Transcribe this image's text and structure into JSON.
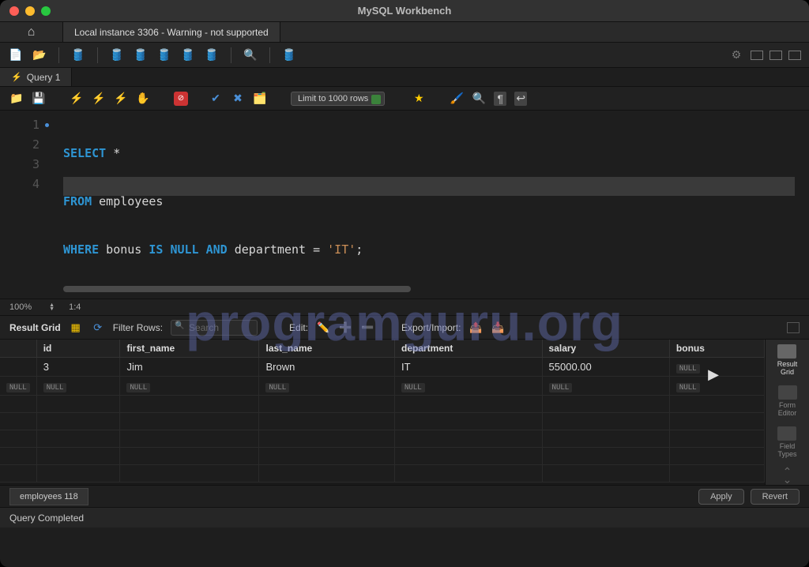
{
  "app": {
    "title": "MySQL Workbench"
  },
  "connection": {
    "tab": "Local instance 3306 - Warning - not supported"
  },
  "queryTab": {
    "label": "Query 1"
  },
  "editor": {
    "limit": "Limit to 1000 rows",
    "lines": [
      "1",
      "2",
      "3",
      "4"
    ],
    "code": {
      "l1_kw": "SELECT",
      "l1_rest": " *",
      "l2_kw": "FROM",
      "l2_rest": " employees",
      "l3_kw1": "WHERE",
      "l3_txt1": " bonus ",
      "l3_kw2": "IS NULL AND",
      "l3_txt2": " department = ",
      "l3_str": "'IT'",
      "l3_end": ";"
    }
  },
  "zoom": {
    "pct": "100%",
    "pos": "1:4"
  },
  "resultToolbar": {
    "title": "Result Grid",
    "filterLabel": "Filter Rows:",
    "searchPlaceholder": "Search",
    "editLabel": "Edit:",
    "exportLabel": "Export/Import:"
  },
  "grid": {
    "columns": [
      "",
      "id",
      "first_name",
      "last_name",
      "department",
      "salary",
      "bonus"
    ],
    "rows": [
      {
        "blank": "",
        "id": "3",
        "first_name": "Jim",
        "last_name": "Brown",
        "department": "IT",
        "salary": "55000.00",
        "bonus": "NULL"
      },
      {
        "blank": "",
        "id": "NULL",
        "first_name": "NULL",
        "last_name": "NULL",
        "department": "NULL",
        "salary": "NULL",
        "bonus": "NULL"
      }
    ],
    "sidebar": {
      "resultGrid": "Result\nGrid",
      "formEditor": "Form\nEditor",
      "fieldTypes": "Field\nTypes"
    }
  },
  "bottom": {
    "tab": "employees 118",
    "apply": "Apply",
    "revert": "Revert"
  },
  "status": {
    "text": "Query Completed"
  },
  "watermark": "programguru.org"
}
